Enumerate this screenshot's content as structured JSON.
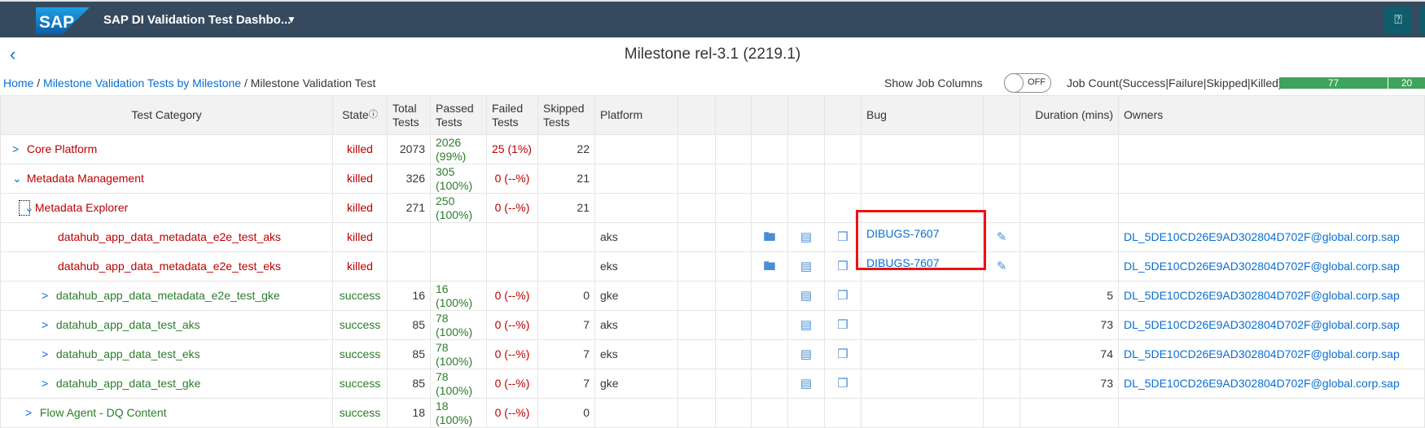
{
  "shell": {
    "app_title": "SAP DI Validation Test Dashbo...",
    "logo": "SAP",
    "help_icon": "?"
  },
  "page": {
    "title": "Milestone rel-3.1 (2219.1)",
    "back": "‹"
  },
  "breadcrumb": {
    "home": "Home",
    "sep": " / ",
    "milestones": "Milestone Validation Tests by Milestone",
    "current": "Milestone Validation Test"
  },
  "controls": {
    "show_job_columns": "Show Job Columns",
    "toggle_state": "OFF",
    "job_count_label": "Job Count(Success|Failure|Skipped|Killed)",
    "job_count": {
      "success": "77",
      "failure": "20"
    }
  },
  "columns": {
    "category": "Test Category",
    "state": "State",
    "state_info": "ⓘ",
    "total": "Total Tests",
    "passed": "Passed Tests",
    "failed": "Failed Tests",
    "skipped": "Skipped Tests",
    "platform": "Platform",
    "bug": "Bug",
    "duration": "Duration (mins)",
    "owners": "Owners"
  },
  "rows": [
    {
      "name": "Core Platform",
      "state": "killed",
      "total": "2073",
      "passed": "2026 (99%)",
      "failed": "25 (1%)",
      "skipped": "22"
    },
    {
      "name": "Metadata Management",
      "state": "killed",
      "total": "326",
      "passed": "305 (100%)",
      "failed": "0 (--%)",
      "skipped": "21"
    },
    {
      "name": "Metadata Explorer",
      "state": "killed",
      "total": "271",
      "passed": "250 (100%)",
      "failed": "0 (--%)",
      "skipped": "21"
    },
    {
      "name": "datahub_app_data_metadata_e2e_test_aks",
      "state": "killed",
      "platform": "aks",
      "bug": "DIBUGS-7607",
      "owner": "DL_5DE10CD26E9AD302804D702F@global.corp.sap"
    },
    {
      "name": "datahub_app_data_metadata_e2e_test_eks",
      "state": "killed",
      "platform": "eks",
      "bug": "DIBUGS-7607",
      "owner": "DL_5DE10CD26E9AD302804D702F@global.corp.sap"
    },
    {
      "name": "datahub_app_data_metadata_e2e_test_gke",
      "state": "success",
      "total": "16",
      "passed": "16 (100%)",
      "failed": "0 (--%)",
      "skipped": "0",
      "platform": "gke",
      "duration": "5",
      "owner": "DL_5DE10CD26E9AD302804D702F@global.corp.sap"
    },
    {
      "name": "datahub_app_data_test_aks",
      "state": "success",
      "total": "85",
      "passed": "78 (100%)",
      "failed": "0 (--%)",
      "skipped": "7",
      "platform": "aks",
      "duration": "73",
      "owner": "DL_5DE10CD26E9AD302804D702F@global.corp.sap"
    },
    {
      "name": "datahub_app_data_test_eks",
      "state": "success",
      "total": "85",
      "passed": "78 (100%)",
      "failed": "0 (--%)",
      "skipped": "7",
      "platform": "eks",
      "duration": "74",
      "owner": "DL_5DE10CD26E9AD302804D702F@global.corp.sap"
    },
    {
      "name": "datahub_app_data_test_gke",
      "state": "success",
      "total": "85",
      "passed": "78 (100%)",
      "failed": "0 (--%)",
      "skipped": "7",
      "platform": "gke",
      "duration": "73",
      "owner": "DL_5DE10CD26E9AD302804D702F@global.corp.sap"
    },
    {
      "name": "Flow Agent - DQ Content",
      "state": "success",
      "total": "18",
      "passed": "18 (100%)",
      "failed": "0 (--%)",
      "skipped": "0"
    }
  ],
  "colors": {
    "shell": "#354a5f",
    "killed": "#bb0000",
    "success": "#2b7d2b",
    "link": "#0a6ed1",
    "bar": "#3fa45b",
    "highlight": "#ee1111"
  }
}
